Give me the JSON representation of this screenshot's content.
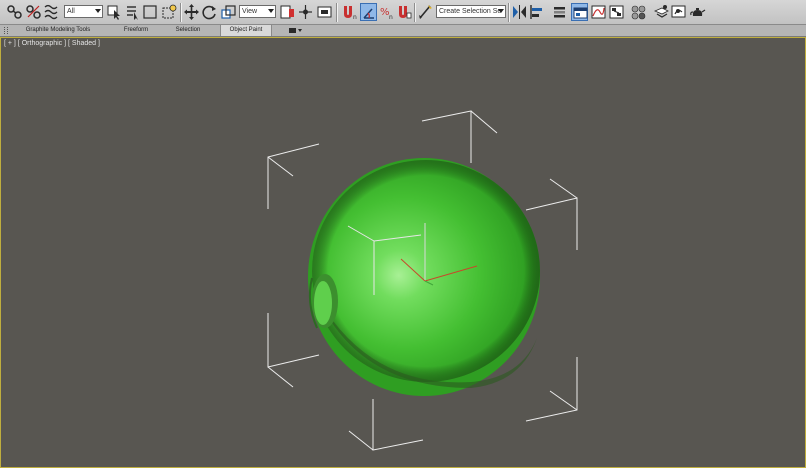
{
  "toolbar": {
    "selection_filter": "All",
    "reference_coord_system": "View",
    "named_selection_set_placeholder": "Create Selection Se"
  },
  "ribbon": {
    "tabs": [
      {
        "label": "Graphite Modeling Tools",
        "active": false
      },
      {
        "label": "Freeform",
        "active": false
      },
      {
        "label": "Selection",
        "active": false
      },
      {
        "label": "Object Paint",
        "active": true
      }
    ]
  },
  "viewport": {
    "label_plus": "[ + ]",
    "label_view": "[ Orthographic ]",
    "label_shading": "[ Shaded ]",
    "active_border_color": "#bfae3e",
    "background_color": "#585651"
  },
  "scene": {
    "object": "sphere",
    "object_color": "#3fb82e",
    "bounding_bracket_color": "#ffffff",
    "axis_colors": {
      "x": "#c8482a",
      "y": "#3fa63a",
      "z": "#c8c8c8"
    }
  }
}
